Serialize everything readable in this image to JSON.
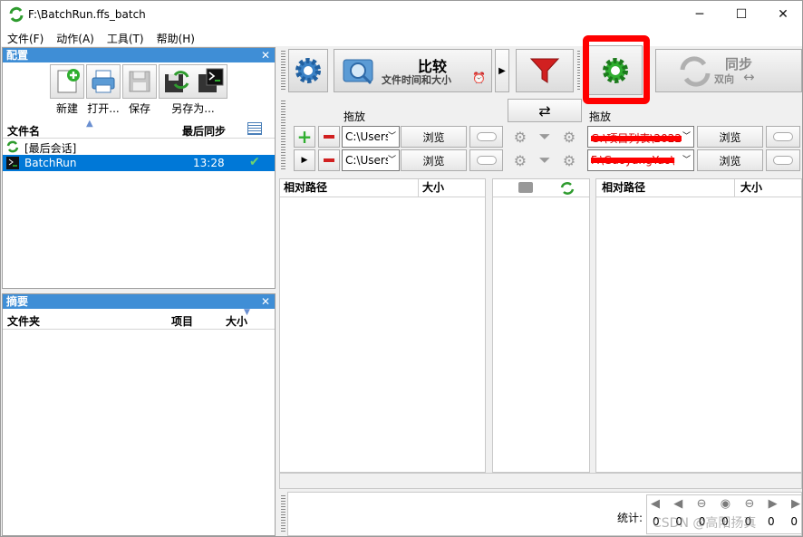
{
  "window": {
    "title": "F:\\BatchRun.ffs_batch",
    "controls": [
      "─",
      "☐",
      "✕"
    ]
  },
  "menu": [
    "文件(F)",
    "动作(A)",
    "工具(T)",
    "帮助(H)"
  ],
  "config_panel": {
    "title": "配置",
    "close": "✕",
    "toolbar": [
      {
        "label": "新建",
        "icon": "new-config-icon"
      },
      {
        "label": "打开...",
        "icon": "printer-open-icon"
      },
      {
        "label": "保存",
        "icon": "save-disk-icon"
      },
      {
        "label": "另存为...",
        "icon": "save-as-batch-icon"
      }
    ],
    "columns": {
      "name": "文件名",
      "last_sync": "最后同步"
    },
    "rows": [
      {
        "name": "[最后会话]",
        "time": "",
        "selected": false
      },
      {
        "name": "BatchRun",
        "time": "13:28",
        "selected": true
      }
    ]
  },
  "summary_panel": {
    "title": "摘要",
    "close": "✕",
    "columns": {
      "folder": "文件夹",
      "items": "项目",
      "size": "大小"
    }
  },
  "toolbar": {
    "compare_title": "比较",
    "compare_sub": "文件时间和大小",
    "sync_title": "同步",
    "sync_sub": "双向",
    "sync_arrows": "↔"
  },
  "folders": {
    "drop_label_left": "拖放",
    "drop_label_right": "拖放",
    "left_path_1": "C:\\Users",
    "left_path_2": "C:\\Users",
    "right_path_1": "G:\\项目列表\\2022",
    "right_path_2": "F:\\GaoyangYao\\",
    "browse": "浏览"
  },
  "grid": {
    "left_cols": [
      "相对路径",
      "大小"
    ],
    "right_cols": [
      "相对路径",
      "大小"
    ]
  },
  "status": {
    "stats_label": "统计:",
    "counts": [
      "0",
      "0",
      "0",
      "0",
      "0",
      "0",
      "0"
    ],
    "watermark": "CSDN @高阳扬真"
  },
  "highlight_color": "#ff0000",
  "accent": "#3f8ed6"
}
